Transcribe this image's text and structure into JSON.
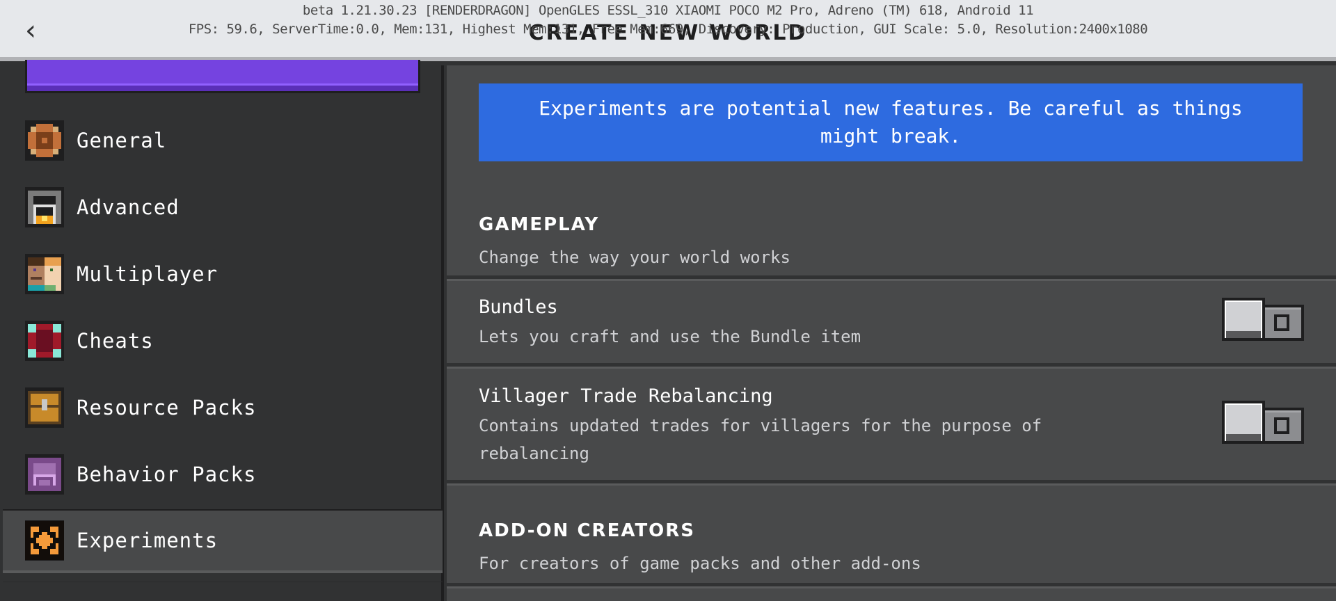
{
  "header": {
    "title": "CREATE NEW WORLD",
    "debug_line1": "beta 1.21.30.23 [RENDERDRAGON] OpenGLES ESSL_310 XIAOMI POCO M2 Pro, Adreno (TM) 618, Android 11",
    "debug_line2": "FPS: 59.6, ServerTime:0.0, Mem:131, Highest Mem:131, Free Mem:669, Discovery: Production, GUI Scale: 5.0, Resolution:2400x1080",
    "back_icon": "‹"
  },
  "sidebar": {
    "items": [
      {
        "label": "General",
        "icon": "gear-icon",
        "active": false
      },
      {
        "label": "Advanced",
        "icon": "furnace-icon",
        "active": false
      },
      {
        "label": "Multiplayer",
        "icon": "players-icon",
        "active": false
      },
      {
        "label": "Cheats",
        "icon": "command-block-icon",
        "active": false
      },
      {
        "label": "Resource Packs",
        "icon": "chest-icon",
        "active": false
      },
      {
        "label": "Behavior Packs",
        "icon": "behavior-pack-icon",
        "active": false
      },
      {
        "label": "Experiments",
        "icon": "experiments-icon",
        "active": true
      }
    ]
  },
  "main": {
    "banner": "Experiments are potential new features. Be careful as things might break.",
    "sections": [
      {
        "title": "GAMEPLAY",
        "description": "Change the way your world works",
        "toggles": [
          {
            "label": "Bundles",
            "description": "Lets you craft and use the Bundle item",
            "enabled": false
          },
          {
            "label": "Villager Trade Rebalancing",
            "description": "Contains updated trades for villagers for the purpose of rebalancing",
            "enabled": false
          }
        ]
      },
      {
        "title": "ADD-ON CREATORS",
        "description": "For creators of game packs and other add-ons"
      }
    ]
  },
  "colors": {
    "banner_blue": "#2e6be0",
    "create_button_purple": "#7543e0",
    "sidebar_bg": "#313233",
    "main_bg": "#48494a",
    "header_bg": "#e6e8eb"
  }
}
